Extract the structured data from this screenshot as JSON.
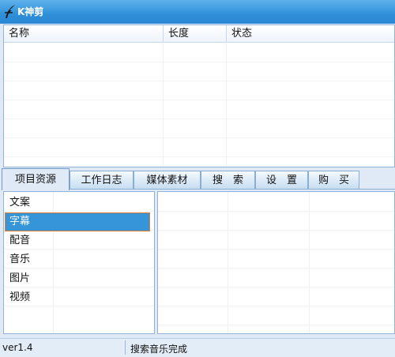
{
  "window": {
    "title": "K神剪",
    "logo_icon": "feather-logo-icon",
    "accent": "#2f8fd8"
  },
  "top_list": {
    "columns": [
      "名称",
      "长度",
      "状态"
    ],
    "rows": []
  },
  "tabs": [
    {
      "label": "项目资源",
      "active": true
    },
    {
      "label": "工作日志",
      "active": false
    },
    {
      "label": "媒体素材",
      "active": false
    },
    {
      "label": "搜　索",
      "active": false
    },
    {
      "label": "设　置",
      "active": false
    },
    {
      "label": "购　买",
      "active": false
    }
  ],
  "resource_list": {
    "items": [
      "文案",
      "字幕",
      "配音",
      "音乐",
      "图片",
      "视频"
    ],
    "selected": "字幕",
    "selection_color": "#3595d8"
  },
  "detail_list": {
    "rows": []
  },
  "status_bar": {
    "version": "ver1.4",
    "message": "搜索音乐完成"
  }
}
